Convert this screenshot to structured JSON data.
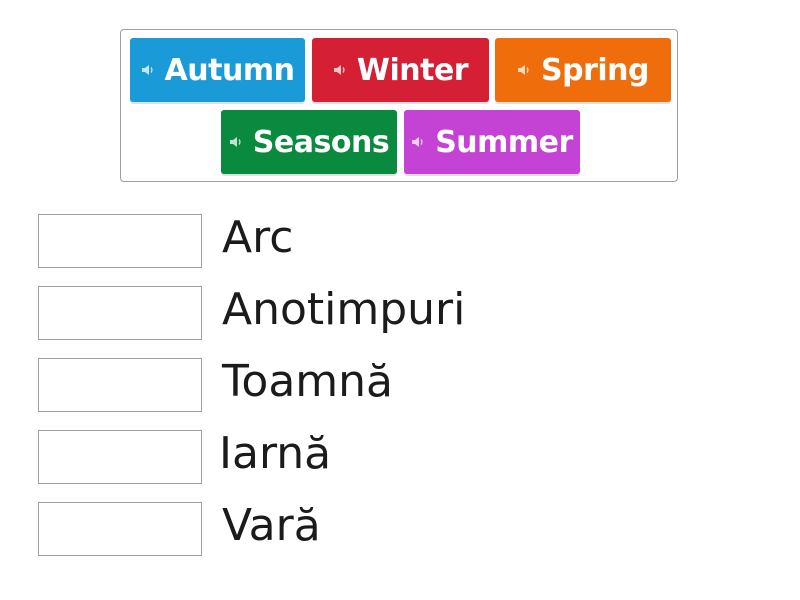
{
  "word_bank": {
    "tiles": [
      {
        "label": "Autumn",
        "color": "#1a9ad7",
        "icon": "speaker-icon"
      },
      {
        "label": "Winter",
        "color": "#d51f35",
        "icon": "speaker-icon"
      },
      {
        "label": "Spring",
        "color": "#f06d0c",
        "icon": "speaker-icon"
      },
      {
        "label": "Seasons",
        "color": "#0a8a3e",
        "icon": "speaker-icon"
      },
      {
        "label": "Summer",
        "color": "#c443d4",
        "icon": "speaker-icon"
      }
    ]
  },
  "targets": [
    {
      "label": "Arc"
    },
    {
      "label": "Anotimpuri"
    },
    {
      "label": "Toamnă"
    },
    {
      "label": "Iarnă"
    },
    {
      "label": "Vară"
    }
  ]
}
